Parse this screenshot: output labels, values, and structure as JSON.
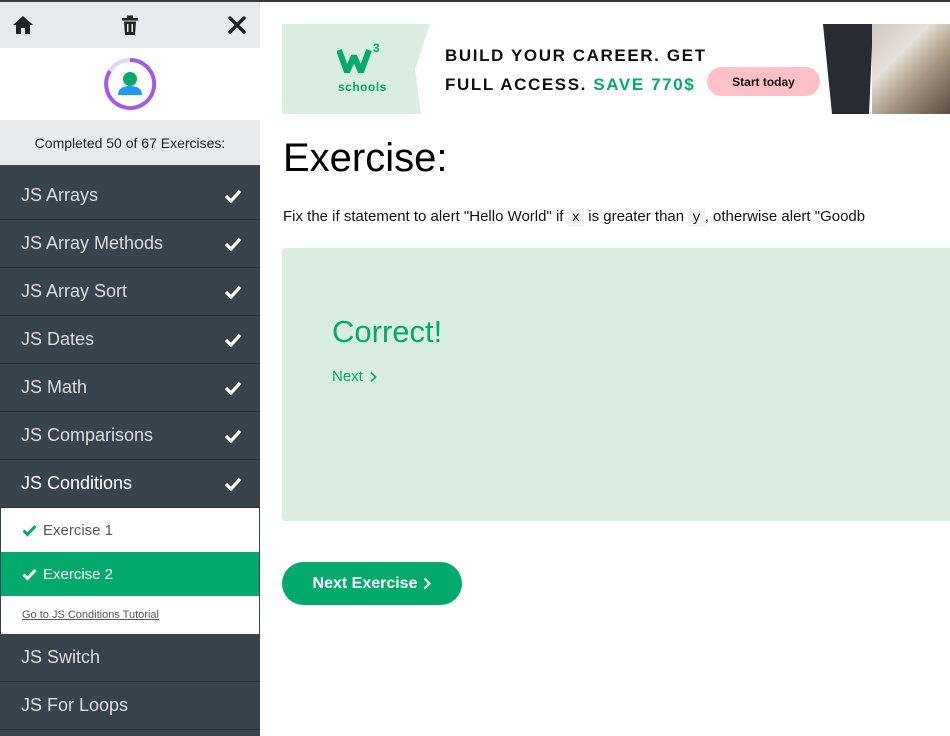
{
  "colors": {
    "accent": "#04aa6d",
    "sidebar_bg": "#38444d",
    "result_bg": "#d9eee1",
    "ad_button": "#ffc0c7"
  },
  "sidebar": {
    "toolbar": {
      "home_icon": "home-icon",
      "trash_icon": "trash-icon",
      "close_icon": "close-icon"
    },
    "avatar_icon": "user-progress-avatar",
    "progress_text": "Completed 50 of 67 Exercises:",
    "items_before": [
      {
        "label": "JS Arrays"
      },
      {
        "label": "JS Array Methods"
      },
      {
        "label": "JS Array Sort"
      },
      {
        "label": "JS Dates"
      },
      {
        "label": "JS Math"
      },
      {
        "label": "JS Comparisons"
      }
    ],
    "active_section": {
      "label": "JS Conditions"
    },
    "sub_items": [
      {
        "label": "Exercise 1"
      },
      {
        "label": "Exercise 2"
      }
    ],
    "tutorial_link": "Go to JS Conditions Tutorial",
    "items_after": [
      {
        "label": "JS Switch"
      },
      {
        "label": "JS For Loops"
      }
    ]
  },
  "ad": {
    "logo_mark": "W",
    "logo_sup": "3",
    "logo_text": "schools",
    "line1": "BUILD YOUR CAREER. GET",
    "line2": "FULL ACCESS.",
    "save": "SAVE 770$",
    "button": "Start today"
  },
  "main": {
    "title": "Exercise:",
    "desc": {
      "p1": "Fix the if statement to alert \"Hello World\" if ",
      "code1": "x",
      "p2": " is greater than ",
      "code2": "y",
      "p3": ", otherwise alert \"Goodb"
    },
    "result_title": "Correct!",
    "result_next": "Next",
    "next_exercise": "Next Exercise"
  }
}
